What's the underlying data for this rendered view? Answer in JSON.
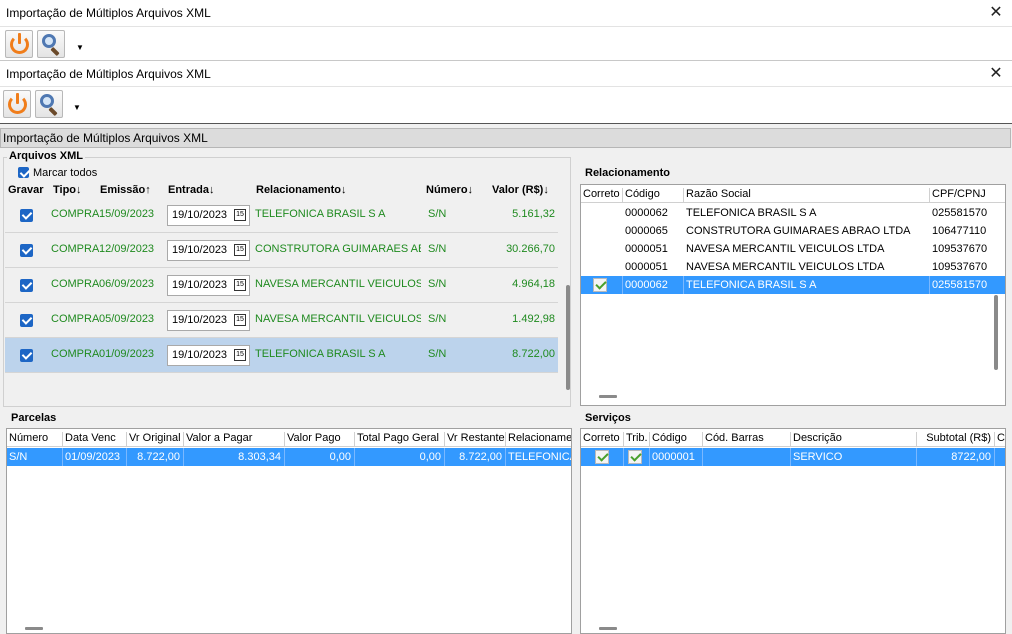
{
  "outer_window": {
    "title": "Importação de Múltiplos Arquivos XML",
    "close": "✕"
  },
  "inner_window": {
    "title": "Importação de Múltiplos Arquivos XML",
    "close": "✕"
  },
  "toolbar": {
    "dropdown": "▼"
  },
  "pane_header": "Importação de Múltiplos Arquivos XML",
  "arquivos": {
    "group_label": "Arquivos XML",
    "mark_all": "Marcar todos",
    "columns": [
      "Gravar",
      "Tipo↓",
      "Emissão↑",
      "Entrada↓",
      "Relacionamento↓",
      "Número↓",
      "Valor (R$)↓"
    ],
    "rows": [
      {
        "tipo": "COMPRA",
        "emissao": "15/09/2023",
        "entrada": "19/10/2023",
        "relacionamento": "TELEFONICA BRASIL S A",
        "numero": "S/N",
        "valor": "5.161,32"
      },
      {
        "tipo": "COMPRA",
        "emissao": "12/09/2023",
        "entrada": "19/10/2023",
        "relacionamento": "CONSTRUTORA GUIMARAES ABRA",
        "numero": "S/N",
        "valor": "30.266,70"
      },
      {
        "tipo": "COMPRA",
        "emissao": "06/09/2023",
        "entrada": "19/10/2023",
        "relacionamento": "NAVESA MERCANTIL VEICULOS LTI",
        "numero": "S/N",
        "valor": "4.964,18"
      },
      {
        "tipo": "COMPRA",
        "emissao": "05/09/2023",
        "entrada": "19/10/2023",
        "relacionamento": "NAVESA MERCANTIL VEICULOS LTI",
        "numero": "S/N",
        "valor": "1.492,98"
      },
      {
        "tipo": "COMPRA",
        "emissao": "01/09/2023",
        "entrada": "19/10/2023",
        "relacionamento": "TELEFONICA BRASIL S A",
        "numero": "S/N",
        "valor": "8.722,00"
      }
    ],
    "calendar_glyph": "15"
  },
  "relacionamento": {
    "group_label": "Relacionamento",
    "columns": [
      "Correto",
      "Código",
      "Razão Social",
      "CPF/CPNJ"
    ],
    "rows": [
      {
        "codigo": "0000062",
        "razao": "TELEFONICA BRASIL S A",
        "cpf": "025581570"
      },
      {
        "codigo": "0000065",
        "razao": "CONSTRUTORA GUIMARAES ABRAO LTDA",
        "cpf": "106477110"
      },
      {
        "codigo": "0000051",
        "razao": "NAVESA MERCANTIL VEICULOS LTDA",
        "cpf": "109537670"
      },
      {
        "codigo": "0000051",
        "razao": "NAVESA MERCANTIL VEICULOS LTDA",
        "cpf": "109537670"
      },
      {
        "codigo": "0000062",
        "razao": "TELEFONICA BRASIL S A",
        "cpf": "025581570"
      }
    ]
  },
  "parcelas": {
    "group_label": "Parcelas",
    "columns": [
      "Número",
      "Data Venc",
      "Vr Original",
      "Valor a Pagar",
      "Valor Pago",
      "Total Pago Geral",
      "Vr Restante",
      "Relacionamer"
    ],
    "row": {
      "numero": "S/N",
      "data_venc": "01/09/2023",
      "vr_original": "8.722,00",
      "valor_a_pagar": "8.303,34",
      "valor_pago": "0,00",
      "total_pago": "0,00",
      "vr_restante": "8.722,00",
      "relacionamento": "TELEFONICA"
    }
  },
  "servicos": {
    "group_label": "Serviços",
    "columns": [
      "Correto",
      "Trib.",
      "Código",
      "Cód. Barras",
      "Descrição",
      "Subtotal (R$)",
      "C"
    ],
    "row": {
      "codigo": "0000001",
      "cod_barras": "",
      "descricao": "SERVICO",
      "subtotal": "8722,00"
    }
  },
  "colors": {
    "accent_green": "#1f8a1f",
    "selection_blue": "#3399ff",
    "row_select": "#bcd3ec",
    "power_orange": "#f07d1a"
  }
}
